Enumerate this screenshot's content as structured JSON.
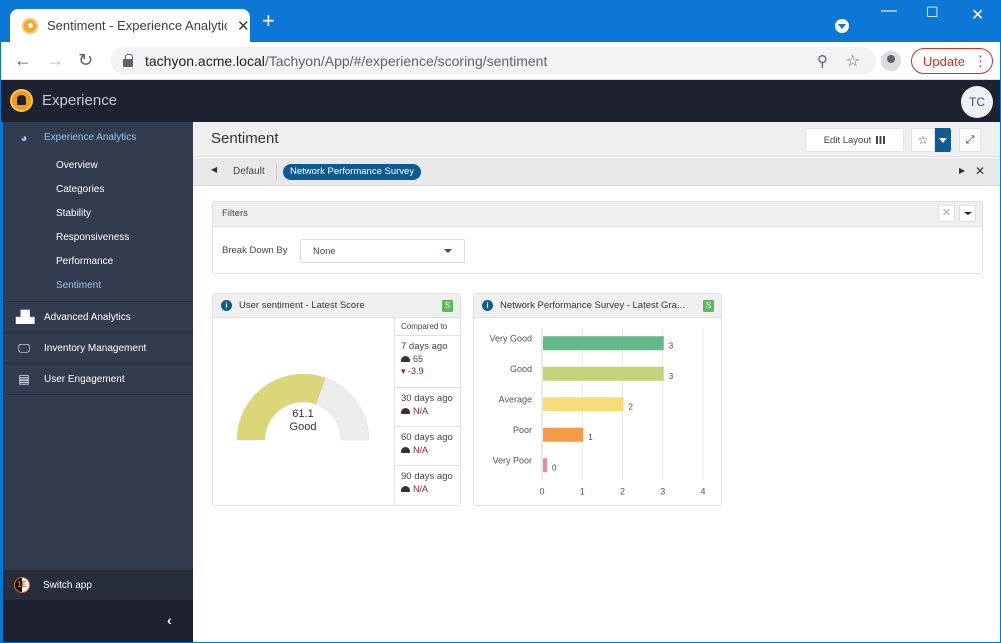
{
  "browser": {
    "tab_title": "Sentiment - Experience Analytics",
    "new_tab": "+",
    "url_host": "tachyon.acme.local",
    "url_path": "/Tachyon/App/#/experience/scoring/sentiment",
    "update_label": "Update",
    "window_controls": {
      "minimize": "—",
      "maximize": "☐",
      "close": "✕"
    }
  },
  "app": {
    "name": "Experience",
    "user_initials": "TC"
  },
  "sidebar": {
    "sections": [
      {
        "label": "Experience Analytics",
        "icon": "gauge-icon",
        "active": true,
        "items": [
          {
            "label": "Overview"
          },
          {
            "label": "Categories"
          },
          {
            "label": "Stability"
          },
          {
            "label": "Responsiveness"
          },
          {
            "label": "Performance"
          },
          {
            "label": "Sentiment",
            "active": true
          }
        ]
      },
      {
        "label": "Advanced Analytics",
        "icon": "binoculars-icon"
      },
      {
        "label": "Inventory Management",
        "icon": "monitor-icon"
      },
      {
        "label": "User Engagement",
        "icon": "clipboard-icon"
      }
    ],
    "switch_app": "Switch app",
    "collapse_icon": "‹"
  },
  "page": {
    "title": "Sentiment",
    "edit_layout": "Edit Layout",
    "tabs": {
      "default": "Default",
      "active": "Network Performance Survey"
    }
  },
  "filters": {
    "title": "Filters",
    "breakdown_label": "Break Down By",
    "breakdown_value": "None"
  },
  "widget_score": {
    "title": "User sentiment - Latest Score",
    "badge": "S",
    "score": "61.1",
    "score_fraction": 0.611,
    "rating": "Good",
    "accent": "#dcd67a",
    "compared_header": "Compared to",
    "comparisons": [
      {
        "period": "7 days ago",
        "value": "65",
        "delta": "-3.9"
      },
      {
        "period": "30 days ago",
        "value": "N/A"
      },
      {
        "period": "60 days ago",
        "value": "N/A"
      },
      {
        "period": "90 days ago",
        "value": "N/A"
      }
    ]
  },
  "widget_survey": {
    "title": "Network Performance Survey - Latest Gra...",
    "badge": "S"
  },
  "chart_data": {
    "type": "bar",
    "orientation": "horizontal",
    "title": "Network Performance Survey - Latest Gra...",
    "categories": [
      "Very Good",
      "Good",
      "Average",
      "Poor",
      "Very Poor"
    ],
    "values": [
      3,
      3,
      2,
      1,
      0
    ],
    "colors": [
      "#63b98a",
      "#c6d37a",
      "#f9dc7a",
      "#f39b45",
      "#ee8a94"
    ],
    "xlim": [
      0,
      4
    ],
    "xticks": [
      "0",
      "1",
      "2",
      "3",
      "4"
    ],
    "grid": true,
    "xlabel": "",
    "ylabel": ""
  }
}
